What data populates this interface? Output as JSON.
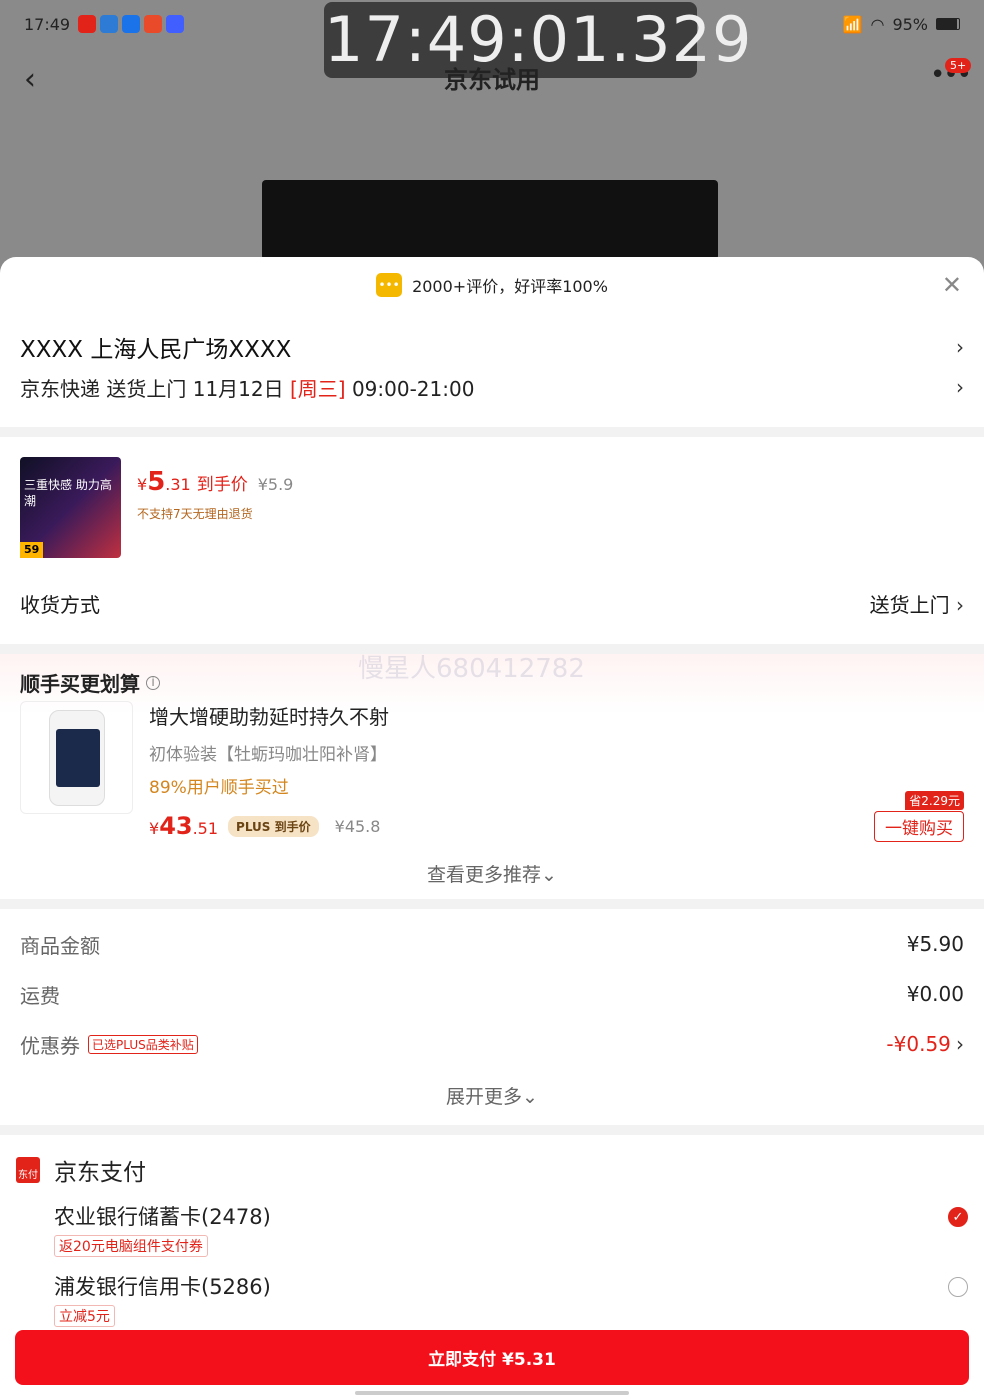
{
  "status_bar": {
    "time": "17:49",
    "right": "95%"
  },
  "clock_overlay": "17:49:01.329",
  "topbar": {
    "title": "京东试用",
    "badge": "5+"
  },
  "sheet": {
    "header": "2000+评价，好评率100%",
    "address": {
      "name": "XXXX  上海人民广场XXXX",
      "delivery_prefix": "京东快递 送货上门 11月12日 ",
      "weekday": "[周三]",
      "delivery_time": " 09:00-21:00"
    },
    "product": {
      "image_text": "三重快感 助力高潮",
      "image_tag": "59",
      "price_currency": "¥",
      "price_int": "5",
      "price_dec": ".31",
      "price_label": "到手价",
      "orig_price": "¥5.9",
      "note": "不支持7天无理由退货"
    },
    "shipping": {
      "label": "收货方式",
      "value": "送货上门"
    },
    "upsell": {
      "title": "顺手买更划算",
      "name": "增大增硬助勃延时持久不射",
      "sub": "初体验装【牡蛎玛咖壮阳补肾】",
      "pct": "89%用户顺手买过",
      "price_currency": "¥",
      "price_int": "43",
      "price_dec": ".51",
      "plus_label": "PLUS 到手价",
      "orig_price": "¥45.8",
      "save_tag": "省2.29元",
      "buy_label": "一键购买",
      "more": "查看更多推荐⌄"
    },
    "fees": [
      {
        "label": "商品金额",
        "value": "¥5.90"
      },
      {
        "label": "运费",
        "value": "¥0.00"
      },
      {
        "label": "优惠券",
        "tag": "已选PLUS品类补贴",
        "value": "-¥0.59"
      }
    ],
    "expand": "展开更多⌄",
    "payment": {
      "title": "京东支付",
      "icon_text": "东付",
      "cards": [
        {
          "name": "农业银行储蓄卡(2478)",
          "tag": "返20元电脑组件支付券"
        },
        {
          "name": "浦发银行信用卡(5286)",
          "tag": "立减5元"
        }
      ]
    },
    "pay_button": "立即支付 ¥5.31"
  },
  "watermark": "慢星人680412782"
}
